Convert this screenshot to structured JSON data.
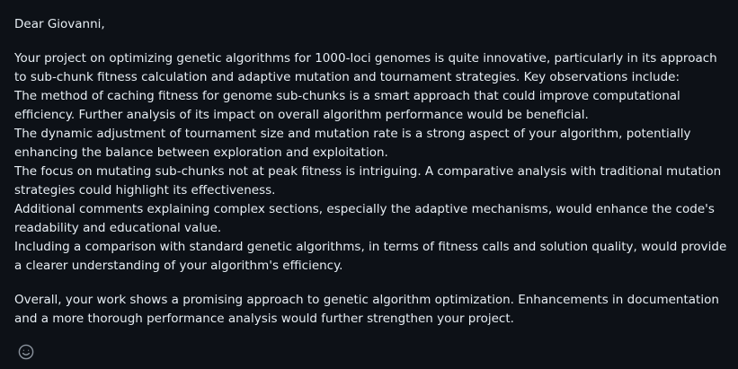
{
  "comment": {
    "greeting": "Dear Giovanni,",
    "intro": "Your project on optimizing genetic algorithms for 1000-loci genomes is quite innovative, particularly in its approach to sub-chunk fitness calculation and adaptive mutation and tournament strategies. Key observations include:",
    "observations": [
      "The method of caching fitness for genome sub-chunks is a smart approach that could improve computational efficiency. Further analysis of its impact on overall algorithm performance would be beneficial.",
      "The dynamic adjustment of tournament size and mutation rate is a strong aspect of your algorithm, potentially enhancing the balance between exploration and exploitation.",
      "The focus on mutating sub-chunks not at peak fitness is intriguing. A comparative analysis with traditional mutation strategies could highlight its effectiveness.",
      "Additional comments explaining complex sections, especially the adaptive mechanisms, would enhance the code's readability and educational value.",
      "Including a comparison with standard genetic algorithms, in terms of fitness calls and solution quality, would provide a clearer understanding of your algorithm's efficiency."
    ],
    "closing": "Overall, your work shows a promising approach to genetic algorithm optimization. Enhancements in documentation and a more thorough performance analysis would further strengthen your project."
  },
  "reaction": {
    "icon": "smiley-icon"
  },
  "colors": {
    "background": "#0d1117",
    "text": "#e6edf3",
    "icon": "#8b949e"
  }
}
